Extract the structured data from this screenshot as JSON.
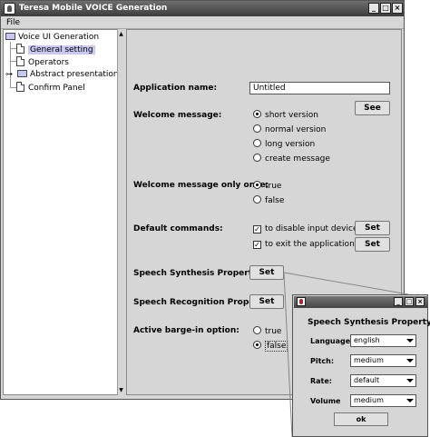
{
  "window": {
    "title": "Teresa Mobile VOICE Generation",
    "controls": {
      "minimize": "_",
      "maximize": "□",
      "close": "×"
    }
  },
  "menubar": {
    "file": "File"
  },
  "tree": {
    "root": "Voice UI Generation",
    "items": [
      {
        "label": "General setting",
        "selected": true,
        "icon": "document-icon"
      },
      {
        "label": "Operators",
        "icon": "document-icon"
      },
      {
        "label": "Abstract presentations",
        "icon": "folder-icon"
      },
      {
        "label": "Confirm Panel",
        "icon": "document-icon"
      }
    ]
  },
  "form": {
    "app_name": {
      "label": "Application name:",
      "value": "Untitled"
    },
    "welcome": {
      "label": "Welcome message:",
      "button": "See",
      "options": [
        "short version",
        "normal version",
        "long version",
        "create message"
      ],
      "selected": "short version"
    },
    "welcome_once": {
      "label": "Welcome message only once:",
      "options": [
        "true",
        "false"
      ],
      "selected": "true"
    },
    "default_commands": {
      "label": "Default commands:",
      "items": [
        {
          "text": "to disable input device",
          "checked": true,
          "button": "Set"
        },
        {
          "text": "to exit the application",
          "checked": true,
          "button": "Set"
        }
      ]
    },
    "speech_synthesis": {
      "label": "Speech Synthesis Property:",
      "button": "Set"
    },
    "speech_recognition": {
      "label": "Speech Recognition Property:",
      "button": "Set"
    },
    "barge_in": {
      "label": "Active barge-in option:",
      "options": [
        "true",
        "false"
      ],
      "selected": "false"
    }
  },
  "dialog": {
    "title": "",
    "heading": "Speech Synthesis Property",
    "fields": [
      {
        "label": "Language:",
        "value": "english"
      },
      {
        "label": "Pitch:",
        "value": "medium"
      },
      {
        "label": "Rate:",
        "value": "default"
      },
      {
        "label": "Volume",
        "value": "medium"
      }
    ],
    "ok": "ok"
  }
}
